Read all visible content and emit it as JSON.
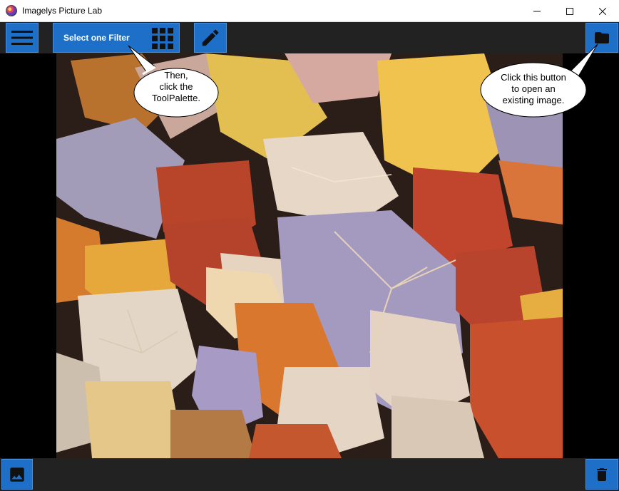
{
  "window": {
    "title": "Imagelys Picture Lab"
  },
  "toolbar": {
    "filter_label": "Select one Filter"
  },
  "callouts": {
    "toolpalette": [
      "Then,",
      "click the",
      "ToolPalette."
    ],
    "open_image": [
      "Click this button",
      "to open an",
      "existing image."
    ]
  },
  "icons": {
    "menu": "hamburger-icon",
    "filter": "grid-icon",
    "edit": "pencil-icon",
    "open": "folder-icon",
    "image": "image-icon",
    "trash": "trash-icon"
  },
  "colors": {
    "button": "#1e6fc7",
    "toolbar": "#222222"
  }
}
